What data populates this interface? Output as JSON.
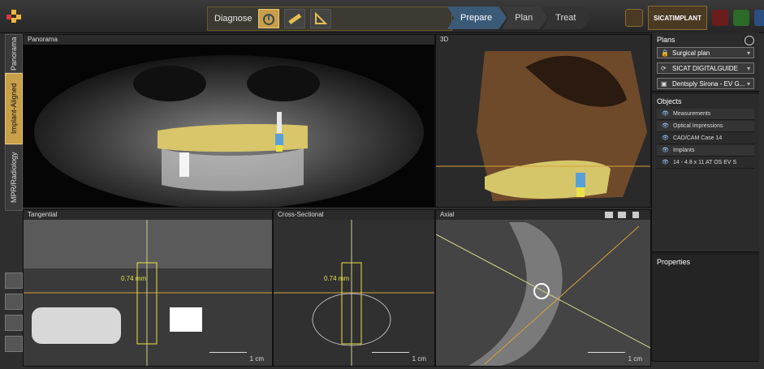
{
  "workflow": {
    "diagnose_label": "Diagnose",
    "steps": [
      {
        "label": "Prepare",
        "state": "active"
      },
      {
        "label": "Plan",
        "state": "inactive"
      },
      {
        "label": "Treat",
        "state": "inactive"
      }
    ]
  },
  "top_right": {
    "app_tab_label": "SICATIMPLANT",
    "app_icons": [
      "implant-app-icon",
      "function-app-icon",
      "air-app-icon",
      "suite-app-icon"
    ]
  },
  "left_tabs": [
    {
      "label": "Panorama",
      "active": false
    },
    {
      "label": "Implant-Aligned",
      "active": true
    },
    {
      "label": "MPR/Radiology",
      "active": false
    }
  ],
  "viewports": {
    "panorama": {
      "title": "Panorama"
    },
    "three_d": {
      "title": "3D"
    },
    "tangential": {
      "title": "Tangential",
      "measurement": "0.74 mm",
      "scale": "1 cm"
    },
    "cross_sectional": {
      "title": "Cross-Sectional",
      "measurement": "0.74 mm",
      "scale": "1 cm"
    },
    "axial": {
      "title": "Axial",
      "scale": "1 cm"
    }
  },
  "panel": {
    "plans": {
      "title": "Plans",
      "plan_select_value": "Surgical plan",
      "guide_select_value": "SICAT DIGITALGUIDE",
      "sleeve_select_value": "Dentsply Sirona - EV G..."
    },
    "objects": {
      "title": "Objects",
      "rows": [
        {
          "label": "Measurements",
          "type": "group"
        },
        {
          "label": "Optical Impressions",
          "type": "group"
        },
        {
          "label": "CAD/CAM Case 14",
          "type": "item"
        },
        {
          "label": "Implants",
          "type": "group"
        },
        {
          "label": "14 - 4.8 x 11 AT OS EV S",
          "type": "item"
        }
      ]
    },
    "properties": {
      "title": "Properties"
    }
  },
  "colors": {
    "accent_gold": "#c8a04a",
    "step_active": "#3a5a78",
    "implant_blue": "#5aa0d8",
    "implant_yellow": "#e8e24a",
    "orange_line": "#d6a33a"
  }
}
